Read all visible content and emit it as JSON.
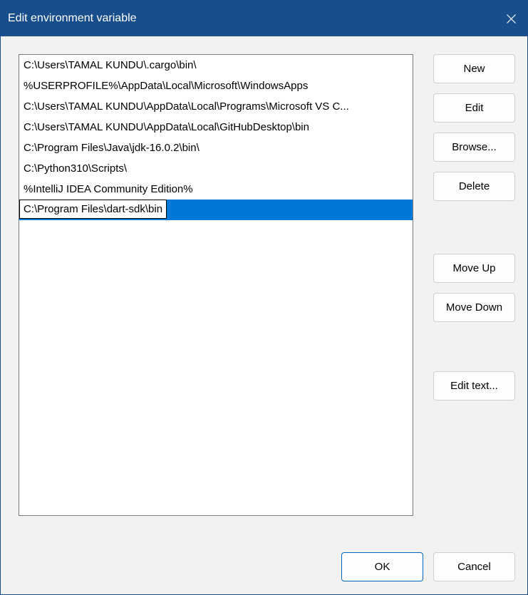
{
  "window": {
    "title": "Edit environment variable"
  },
  "paths": [
    "C:\\Users\\TAMAL KUNDU\\.cargo\\bin\\",
    "%USERPROFILE%\\AppData\\Local\\Microsoft\\WindowsApps",
    "C:\\Users\\TAMAL KUNDU\\AppData\\Local\\Programs\\Microsoft VS C...",
    "C:\\Users\\TAMAL KUNDU\\AppData\\Local\\GitHubDesktop\\bin",
    "C:\\Program Files\\Java\\jdk-16.0.2\\bin\\",
    "C:\\Python310\\Scripts\\",
    "%IntelliJ IDEA Community Edition%",
    "C:\\Program Files\\dart-sdk\\bin"
  ],
  "selected_index": 7,
  "edit_value": "C:\\Program Files\\dart-sdk\\bin",
  "buttons": {
    "new": "New",
    "edit": "Edit",
    "browse": "Browse...",
    "delete": "Delete",
    "move_up": "Move Up",
    "move_down": "Move Down",
    "edit_text": "Edit text...",
    "ok": "OK",
    "cancel": "Cancel"
  },
  "colors": {
    "titlebar": "#184e8b",
    "selection": "#0078d7",
    "accent_border": "#0067c0"
  }
}
